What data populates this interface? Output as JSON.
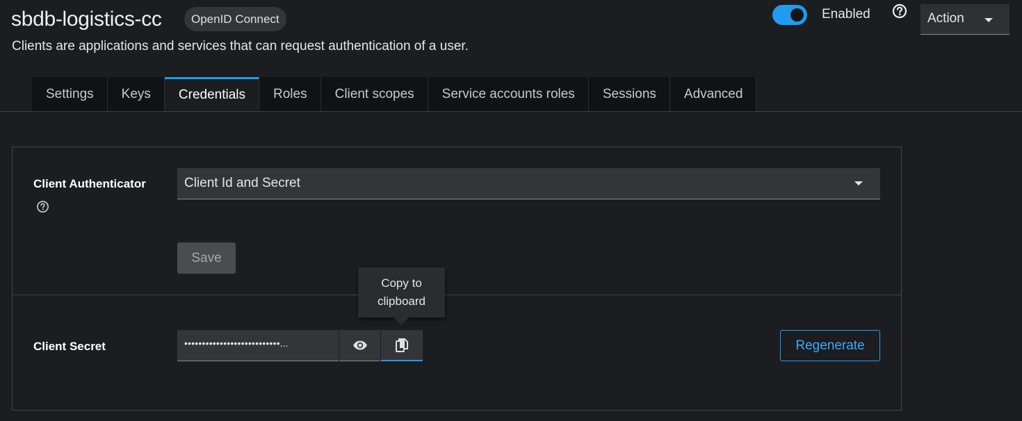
{
  "header": {
    "title": "sbdb-logistics-cc",
    "protocol_badge": "OpenID Connect",
    "subtitle": "Clients are applications and services that can request authentication of a user.",
    "enabled": true,
    "enabled_label": "Enabled",
    "action_label": "Action"
  },
  "tabs": [
    {
      "label": "Settings",
      "active": false
    },
    {
      "label": "Keys",
      "active": false
    },
    {
      "label": "Credentials",
      "active": true
    },
    {
      "label": "Roles",
      "active": false
    },
    {
      "label": "Client scopes",
      "active": false
    },
    {
      "label": "Service accounts roles",
      "active": false
    },
    {
      "label": "Sessions",
      "active": false
    },
    {
      "label": "Advanced",
      "active": false
    }
  ],
  "credentials": {
    "authenticator_label": "Client Authenticator",
    "authenticator_value": "Client Id and Secret",
    "save_label": "Save",
    "secret_label": "Client Secret",
    "secret_masked": "•••••••••••••••••••••••••••...",
    "tooltip_line1": "Copy to",
    "tooltip_line2": "clipboard",
    "regenerate_label": "Regenerate"
  },
  "colors": {
    "accent": "#1f9cf0",
    "background": "#1b1d21"
  },
  "icons": [
    "help-icon",
    "caret-down-icon",
    "eye-icon",
    "copy-icon"
  ]
}
